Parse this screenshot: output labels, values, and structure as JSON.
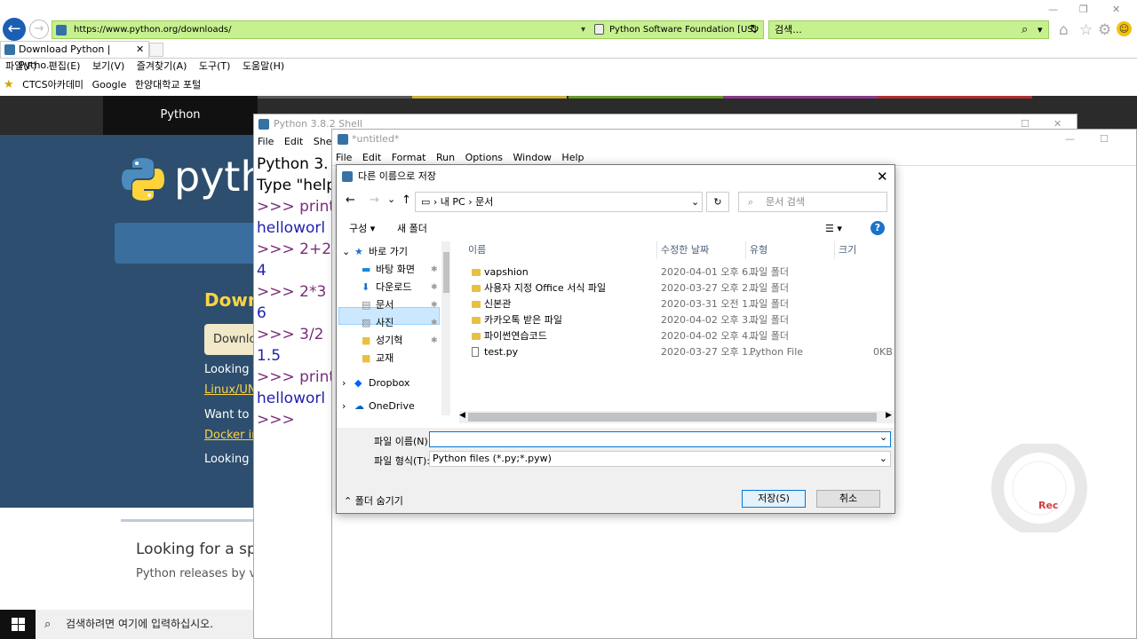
{
  "browser": {
    "url": "https://www.python.org/downloads/",
    "org": "Python Software Foundation [US]",
    "search_placeholder": "검색...",
    "tab_title": "Download Python | Pytho...",
    "menu": [
      "파일(F)",
      "편집(E)",
      "보기(V)",
      "즐겨찾기(A)",
      "도구(T)",
      "도움말(H)"
    ],
    "favorites": [
      "CTCS아카데미",
      "Google",
      "한양대학교 포털"
    ]
  },
  "site": {
    "nav_active": "Python",
    "logo_text": "pyth",
    "download_title": "Downl",
    "download_btn": "Downlo",
    "looking1": "Looking f",
    "linux_link": "Linux/UN",
    "want": "Want to h",
    "docker_link": "Docker in",
    "looking2": "Looking f",
    "spec_title": "Looking for a sp",
    "spec_sub": "Python releases by ver"
  },
  "shell": {
    "title": "Python 3.8.2 Shell",
    "menu": [
      "File",
      "Edit",
      "Shell"
    ],
    "lines": [
      {
        "t": "Python 3.",
        "c": "plain"
      },
      {
        "t": "Type \"help",
        "c": "plain"
      },
      {
        "t": ">>> print('",
        "c": "prompt"
      },
      {
        "t": "helloworl",
        "c": "out"
      },
      {
        "t": ">>> 2+2",
        "c": "prompt"
      },
      {
        "t": "4",
        "c": "out"
      },
      {
        "t": ">>> 2*3",
        "c": "prompt"
      },
      {
        "t": "6",
        "c": "out"
      },
      {
        "t": ">>> 3/2",
        "c": "prompt"
      },
      {
        "t": "1.5",
        "c": "out"
      },
      {
        "t": ">>> print('",
        "c": "prompt"
      },
      {
        "t": "helloworl",
        "c": "out"
      },
      {
        "t": ">>>",
        "c": "prompt"
      }
    ]
  },
  "editor": {
    "title": "*untitled*",
    "menu": [
      "File",
      "Edit",
      "Format",
      "Run",
      "Options",
      "Window",
      "Help"
    ]
  },
  "dialog": {
    "title": "다른 이름으로 저장",
    "path": [
      "내 PC",
      "문서"
    ],
    "search_placeholder": "문서 검색",
    "organize": "구성 ▾",
    "new_folder": "새 폴더",
    "tree": [
      {
        "label": "바로 가기",
        "icon": "star-icon",
        "indent": 0,
        "expander": "⌄"
      },
      {
        "label": "바탕 화면",
        "icon": "desktop-icon",
        "indent": 1,
        "pin": true
      },
      {
        "label": "다운로드",
        "icon": "download-icon",
        "indent": 1,
        "pin": true
      },
      {
        "label": "문서",
        "icon": "document-icon",
        "indent": 1,
        "pin": true,
        "selected": true
      },
      {
        "label": "사진",
        "icon": "picture-icon",
        "indent": 1,
        "pin": true
      },
      {
        "label": "성기혁",
        "icon": "folder-icon",
        "indent": 1,
        "pin": true
      },
      {
        "label": "교재",
        "icon": "folder-icon",
        "indent": 1
      },
      {
        "label": "Dropbox",
        "icon": "dropbox-icon",
        "indent": 0,
        "expander": "›"
      },
      {
        "label": "OneDrive",
        "icon": "onedrive-icon",
        "indent": 0,
        "expander": "›"
      }
    ],
    "columns": [
      "이름",
      "수정한 날짜",
      "유형",
      "크기"
    ],
    "files": [
      {
        "name": "vapshion",
        "date": "2020-04-01 오후 6...",
        "type": "파일 폴더",
        "size": "",
        "kind": "folder"
      },
      {
        "name": "사용자 지정 Office 서식 파일",
        "date": "2020-03-27 오후 2...",
        "type": "파일 폴더",
        "size": "",
        "kind": "folder"
      },
      {
        "name": "신본관",
        "date": "2020-03-31 오전 1...",
        "type": "파일 폴더",
        "size": "",
        "kind": "folder"
      },
      {
        "name": "카카오톡 받은 파일",
        "date": "2020-04-02 오후 3...",
        "type": "파일 폴더",
        "size": "",
        "kind": "folder"
      },
      {
        "name": "파이썬연습코드",
        "date": "2020-04-02 오후 4...",
        "type": "파일 폴더",
        "size": "",
        "kind": "folder"
      },
      {
        "name": "test.py",
        "date": "2020-03-27 오후 1...",
        "type": "Python File",
        "size": "0KB",
        "kind": "py"
      }
    ],
    "filename_label": "파일 이름(N):",
    "filename_value": "",
    "filetype_label": "파일 형식(T):",
    "filetype_value": "Python files (*.py;*.pyw)",
    "hide_folders": "폴더 숨기기",
    "save": "저장(S)",
    "cancel": "취소"
  },
  "taskbar": {
    "search_placeholder": "검색하려면 여기에 입력하십시오."
  },
  "recorder": {
    "label": "Rec"
  }
}
